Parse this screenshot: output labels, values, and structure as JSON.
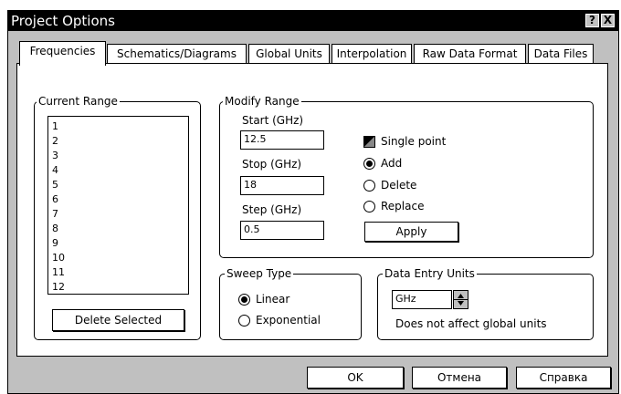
{
  "window": {
    "title": "Project Options",
    "help_glyph": "?",
    "close_glyph": "X"
  },
  "tabs": [
    {
      "label": "Frequencies"
    },
    {
      "label": "Schematics/Diagrams"
    },
    {
      "label": "Global Units"
    },
    {
      "label": "Interpolation"
    },
    {
      "label": "Raw Data Format"
    },
    {
      "label": "Data Files"
    }
  ],
  "current_range": {
    "title": "Current Range",
    "items": [
      "1",
      "2",
      "3",
      "4",
      "5",
      "6",
      "7",
      "8",
      "9",
      "10",
      "11",
      "12"
    ],
    "delete_label": "Delete Selected"
  },
  "modify_range": {
    "title": "Modify Range",
    "start_label": "Start (GHz)",
    "start_value": "12.5",
    "stop_label": "Stop (GHz)",
    "stop_value": "18",
    "step_label": "Step (GHz)",
    "step_value": "0.5",
    "single_point_label": "Single point",
    "add_label": "Add",
    "delete_label": "Delete",
    "replace_label": "Replace",
    "apply_label": "Apply",
    "selected_action": "Add"
  },
  "sweep_type": {
    "title": "Sweep Type",
    "linear_label": "Linear",
    "exponential_label": "Exponential",
    "selected": "Linear"
  },
  "data_entry_units": {
    "title": "Data Entry Units",
    "unit_value": "GHz",
    "note": "Does not affect global units"
  },
  "footer": {
    "ok_label": "OK",
    "cancel_label": "Отмена",
    "help_label": "Справка"
  }
}
